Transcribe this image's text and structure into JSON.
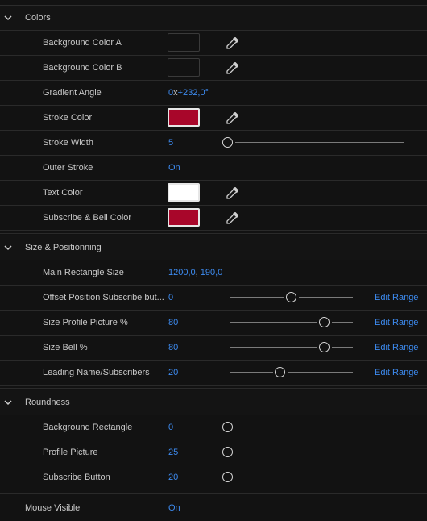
{
  "colors_section": {
    "title": "Colors",
    "bg_color_a": {
      "label": "Background Color A",
      "color": "#121212"
    },
    "bg_color_b": {
      "label": "Background Color B",
      "color": "#121212"
    },
    "gradient_angle": {
      "label": "Gradient Angle",
      "turns": "0",
      "x": "x",
      "degrees": "+232,0",
      "deg_sign": "°"
    },
    "stroke_color": {
      "label": "Stroke Color",
      "color": "#a8062a"
    },
    "stroke_width": {
      "label": "Stroke Width",
      "value": "5",
      "slider_fraction": 0.0
    },
    "outer_stroke": {
      "label": "Outer Stroke",
      "value": "On"
    },
    "text_color": {
      "label": "Text Color",
      "color": "#ffffff"
    },
    "subscribe_bell_color": {
      "label": "Subscribe & Bell Color",
      "color": "#a8062a"
    }
  },
  "size_section": {
    "title": "Size & Positionning",
    "main_rect_size": {
      "label": "Main Rectangle Size",
      "w": "1200,0",
      "sep": ",",
      "h": "190,0"
    },
    "offset_subscribe": {
      "label": "Offset Position Subscribe but...",
      "value": "0",
      "slider_fraction": 0.5,
      "edit_label": "Edit Range"
    },
    "size_profile_picture": {
      "label": "Size Profile Picture %",
      "value": "80",
      "slider_fraction": 0.8,
      "edit_label": "Edit Range"
    },
    "size_bell": {
      "label": "Size Bell %",
      "value": "80",
      "slider_fraction": 0.8,
      "edit_label": "Edit Range"
    },
    "leading_name": {
      "label": "Leading Name/Subscribers",
      "value": "20",
      "slider_fraction": 0.4,
      "edit_label": "Edit Range"
    }
  },
  "roundness_section": {
    "title": "Roundness",
    "background_rectangle": {
      "label": "Background Rectangle",
      "value": "0",
      "slider_fraction": 0.0
    },
    "profile_picture": {
      "label": "Profile Picture",
      "value": "25",
      "slider_fraction": 0.0
    },
    "subscribe_button": {
      "label": "Subscribe Button",
      "value": "20",
      "slider_fraction": 0.0
    }
  },
  "mouse_visible": {
    "label": "Mouse Visible",
    "value": "On"
  },
  "icons": {
    "chevron": "chevron-down-icon",
    "eyedropper": "eyedropper-icon"
  },
  "accent_color": "#3d8bf0"
}
